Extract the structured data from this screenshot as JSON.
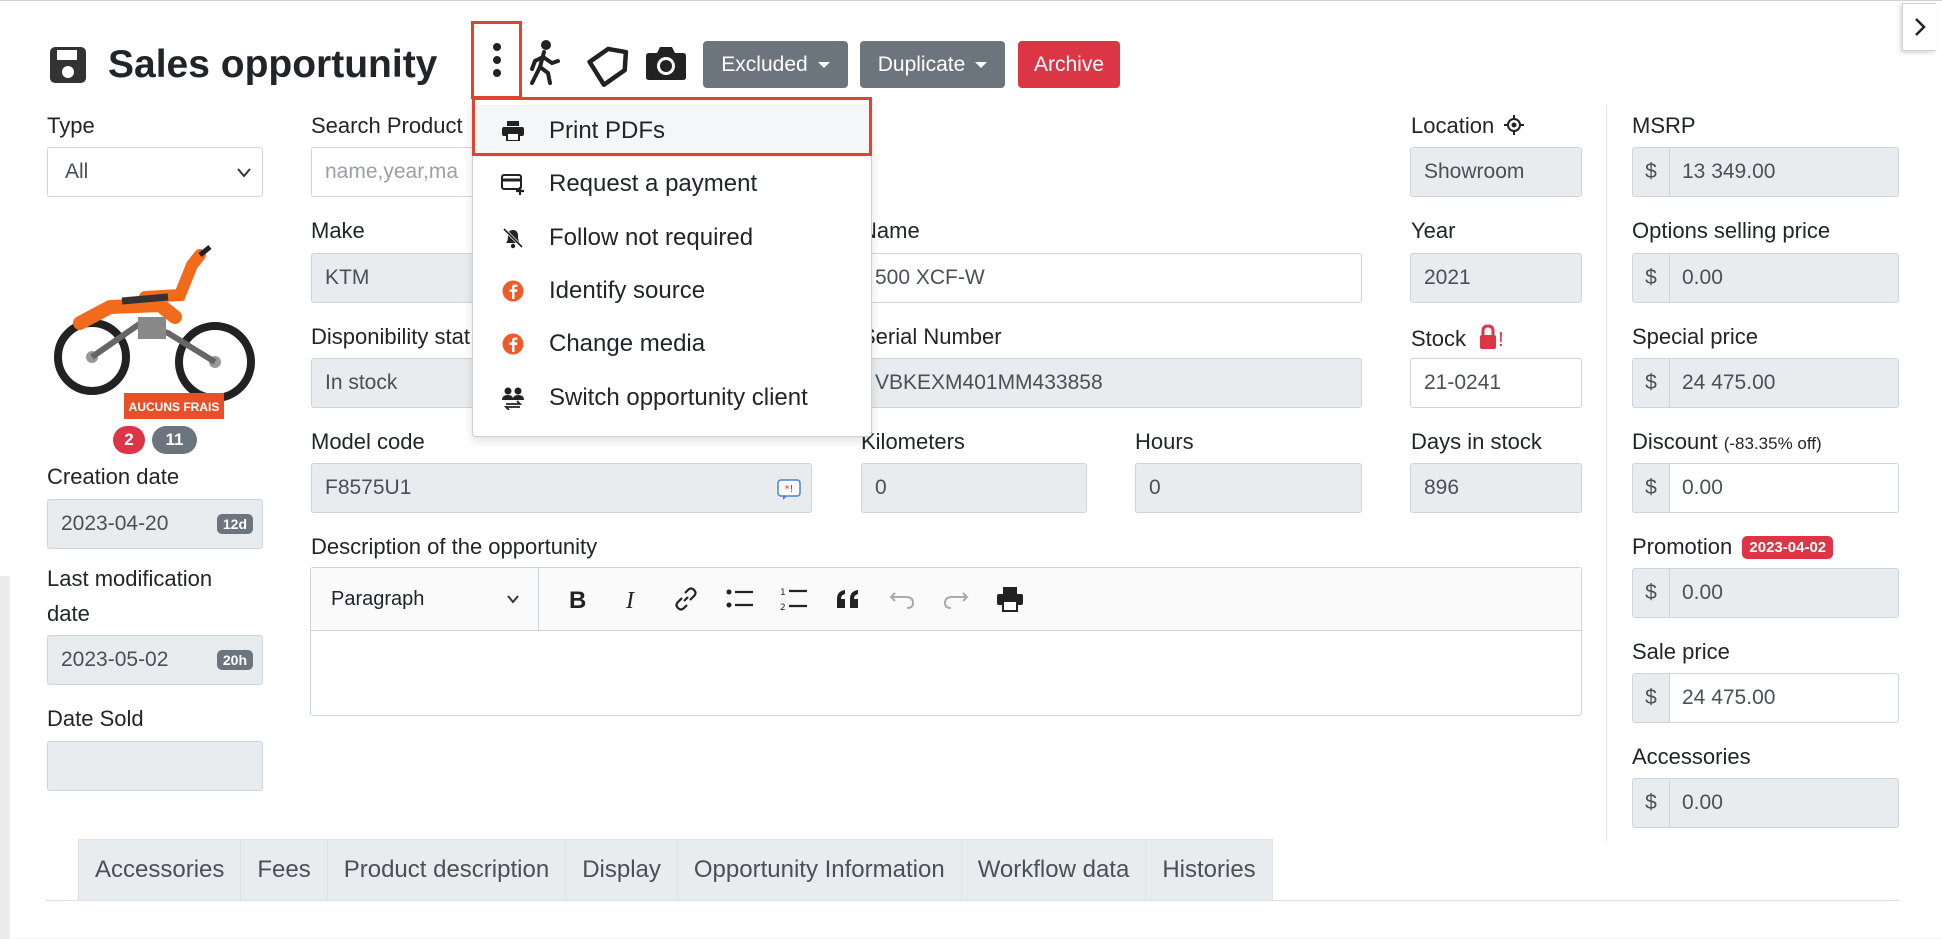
{
  "header": {
    "title": "Sales opportunity",
    "excluded_label": "Excluded",
    "duplicate_label": "Duplicate",
    "archive_label": "Archive"
  },
  "dropdown": {
    "items": [
      {
        "label": "Print PDFs",
        "icon": "printer-icon"
      },
      {
        "label": "Request a payment",
        "icon": "card-plus-icon"
      },
      {
        "label": "Follow not required",
        "icon": "bell-slash-icon"
      },
      {
        "label": "Identify source",
        "icon": "facebook-icon"
      },
      {
        "label": "Change media",
        "icon": "facebook-icon"
      },
      {
        "label": "Switch opportunity client",
        "icon": "users-swap-icon"
      }
    ]
  },
  "left": {
    "type_label": "Type",
    "type_value": "All",
    "pill_red": "2",
    "pill_grey": "11",
    "creation_label": "Creation date",
    "creation_value": "2023-04-20",
    "creation_badge": "12d",
    "lastmod_label_1": "Last modification",
    "lastmod_label_2": "date",
    "lastmod_value": "2023-05-02",
    "lastmod_badge": "20h",
    "sold_label": "Date Sold",
    "sold_value": ""
  },
  "form": {
    "search_label": "Search Product",
    "search_placeholder": "name,year,ma",
    "make_label": "Make",
    "make_value": "KTM",
    "name_label": "Name",
    "name_value": "500 XCF-W",
    "dispo_label": "Disponibility stat",
    "dispo_value": "In stock",
    "serial_label": "Serial Number",
    "serial_value": "VBKEXM401MM433858",
    "model_label": "Model code",
    "model_value": "F8575U1",
    "km_label": "Kilometers",
    "km_value": "0",
    "hours_label": "Hours",
    "hours_value": "0",
    "location_label": "Location",
    "location_value": "Showroom",
    "year_label": "Year",
    "year_value": "2021",
    "stock_label": "Stock",
    "stock_mark": "!",
    "stock_value": "21-0241",
    "days_label": "Days in stock",
    "days_value": "896",
    "desc_label": "Description of the opportunity",
    "paragraph_label": "Paragraph"
  },
  "pricing": {
    "currency": "$",
    "msrp_label": "MSRP",
    "msrp_value": "13 349.00",
    "options_label": "Options selling price",
    "options_value": "0.00",
    "special_label": "Special price",
    "special_value": "24 475.00",
    "discount_label": "Discount",
    "discount_note": "(-83.35% off)",
    "discount_value": "0.00",
    "promo_label": "Promotion",
    "promo_date": "2023-04-02",
    "promo_value": "0.00",
    "sale_label": "Sale price",
    "sale_value": "24 475.00",
    "acc_label": "Accessories",
    "acc_value": "0.00"
  },
  "tabs": [
    "Accessories",
    "Fees",
    "Product description",
    "Display",
    "Opportunity Information",
    "Workflow data",
    "Histories"
  ],
  "moto_banner": "AUCUNS FRAIS",
  "colors": {
    "accent_red": "#dc3545",
    "grey_button": "#6c757d",
    "highlight": "#e0442c"
  }
}
